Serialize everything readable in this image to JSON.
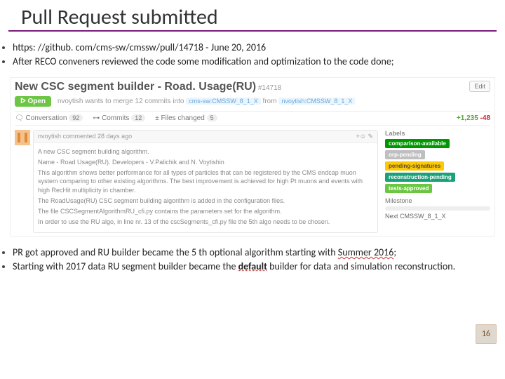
{
  "title": "Pull Request submitted",
  "top_bullets": [
    "https: //github. com/cms-sw/cmssw/pull/14718   - June 20, 2016",
    "After RECO conveners reviewed the code some modification and optimization to the code done;"
  ],
  "github": {
    "title": "New CSC segment builder - Road. Usage(RU)",
    "number": "#14718",
    "edit": "Edit",
    "state": "Open",
    "merge_text_1": "nvoytish wants to merge 12 commits into",
    "branch_base": "cms-sw:CMSSW_8_1_X",
    "merge_text_2": "from",
    "branch_head": "nvoytish:CMSSW_8_1_X",
    "tabs": {
      "conversation": "Conversation",
      "conversation_count": "92",
      "commits": "Commits",
      "commits_count": "12",
      "files": "Files changed",
      "files_count": "5"
    },
    "diff": {
      "add": "+1,235",
      "del": "-48"
    },
    "comment": {
      "header": "nvoytish commented 28 days ago",
      "header_right": "+☺   ✎",
      "lines": [
        "A new CSC segment building algorithm.",
        "Name - Road Usage(RU). Developers - V.Palichik and N. Voytishin",
        "This algorithm shows better performance for all types of particles that can be registered by the CMS endcap muon system comparing to other existing algorithms. The best improvement is achieved for high Pt muons and events with high RecHit multiplicity in chamber.",
        "The RoadUsage(RU) CSC segment building algorithm is added in the configuration files.",
        "The file CSCSegmentAlgorithmRU_cfi.py contains the parameters set for the algorithm.",
        "In order to use the RU algo, in line nr. 13 of the cscSegments_cfi.py file the 5th algo needs to be chosen."
      ]
    },
    "sidebar": {
      "labels_title": "Labels",
      "labels": [
        {
          "text": "comparison-available",
          "cls": "l-dkgreen"
        },
        {
          "text": "orp-pending",
          "cls": "l-gray"
        },
        {
          "text": "pending-signatures",
          "cls": "l-orange"
        },
        {
          "text": "reconstruction-pending",
          "cls": "l-sea"
        },
        {
          "text": "tests-approved",
          "cls": "l-green"
        }
      ],
      "milestone_title": "Milestone",
      "milestone_value": "Next CMSSW_8_1_X"
    }
  },
  "bottom_bullets": [
    "PR got approved and RU builder became the 5 th optional algorithm starting with Summer 2016;",
    "Starting with 2017 data RU segment builder became the default builder for data and simulation reconstruction."
  ],
  "bottom_html_1a": "PR got approved and RU builder became the 5",
  "bottom_html_1_th": " th ",
  "bottom_html_1b": "optional algorithm starting with ",
  "bottom_html_1_summer": "Summer 2016",
  "bottom_html_1c": ";",
  "bottom_html_2a": "Starting with 2017 data RU segment builder became the ",
  "bottom_html_2_default": "default",
  "bottom_html_2b": " builder for data and simulation reconstruction.",
  "page_number": "16"
}
